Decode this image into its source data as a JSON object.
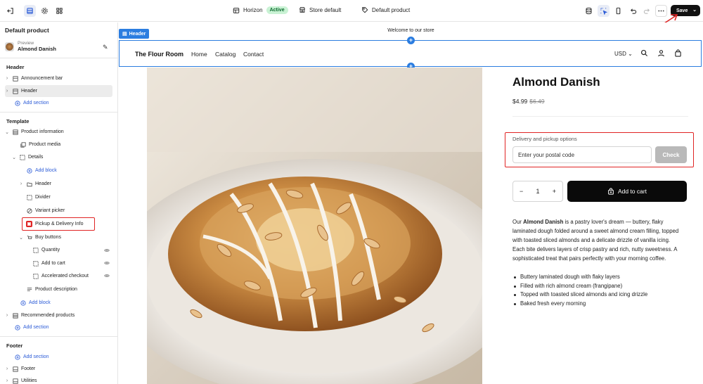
{
  "topbar": {
    "theme_name": "Horizon",
    "theme_status": "Active",
    "store_label": "Store default",
    "template_label": "Default product",
    "save_label": "Save"
  },
  "sidebar": {
    "title": "Default product",
    "preview_label": "Preview",
    "preview_product": "Almond Danish",
    "header_section": "Header",
    "header_items": [
      {
        "label": "Announcement bar"
      },
      {
        "label": "Header"
      }
    ],
    "add_section": "Add section",
    "template_section": "Template",
    "template_items": [
      {
        "label": "Product information"
      },
      {
        "label": "Product media"
      },
      {
        "label": "Details"
      },
      {
        "label": "Add block"
      },
      {
        "label": "Header"
      },
      {
        "label": "Divider"
      },
      {
        "label": "Variant picker"
      },
      {
        "label": "Pickup & Delivery Info"
      },
      {
        "label": "Buy buttons"
      },
      {
        "label": "Quantity"
      },
      {
        "label": "Add to cart"
      },
      {
        "label": "Accelerated checkout"
      },
      {
        "label": "Product description"
      },
      {
        "label": "Add block"
      },
      {
        "label": "Recommended products"
      },
      {
        "label": "Add section"
      }
    ],
    "footer_section": "Footer",
    "footer_items": [
      {
        "label": "Add section"
      },
      {
        "label": "Footer"
      },
      {
        "label": "Utilities"
      }
    ]
  },
  "preview": {
    "announcement": "Welcome to our store",
    "header_tag": "Header",
    "store_name": "The Flour Room",
    "nav": [
      "Home",
      "Catalog",
      "Contact"
    ],
    "currency": "USD",
    "product": {
      "title": "Almond Danish",
      "price": "$4.99",
      "compare_price": "$6.49",
      "delivery_label": "Delivery and pickup options",
      "postal_placeholder": "Enter your postal code",
      "check_label": "Check",
      "quantity": "1",
      "add_to_cart": "Add to cart",
      "desc_intro": "Our ",
      "desc_bold": "Almond Danish",
      "desc_rest": " is a pastry lover's dream — buttery, flaky laminated dough folded around a sweet almond cream filling, topped with toasted sliced almonds and a delicate drizzle of vanilla icing. Each bite delivers layers of crisp pastry and rich, nutty sweetness. A sophisticated treat that pairs perfectly with your morning coffee.",
      "bullets": [
        "Buttery laminated dough with flaky layers",
        "Filled with rich almond cream (frangipane)",
        "Topped with toasted sliced almonds and icing drizzle",
        "Baked fresh every morning"
      ]
    }
  },
  "colors": {
    "accent": "#2b7de0",
    "annotation": "#e02424",
    "save_bg": "#111111",
    "active_badge": "#c9f2d4"
  }
}
